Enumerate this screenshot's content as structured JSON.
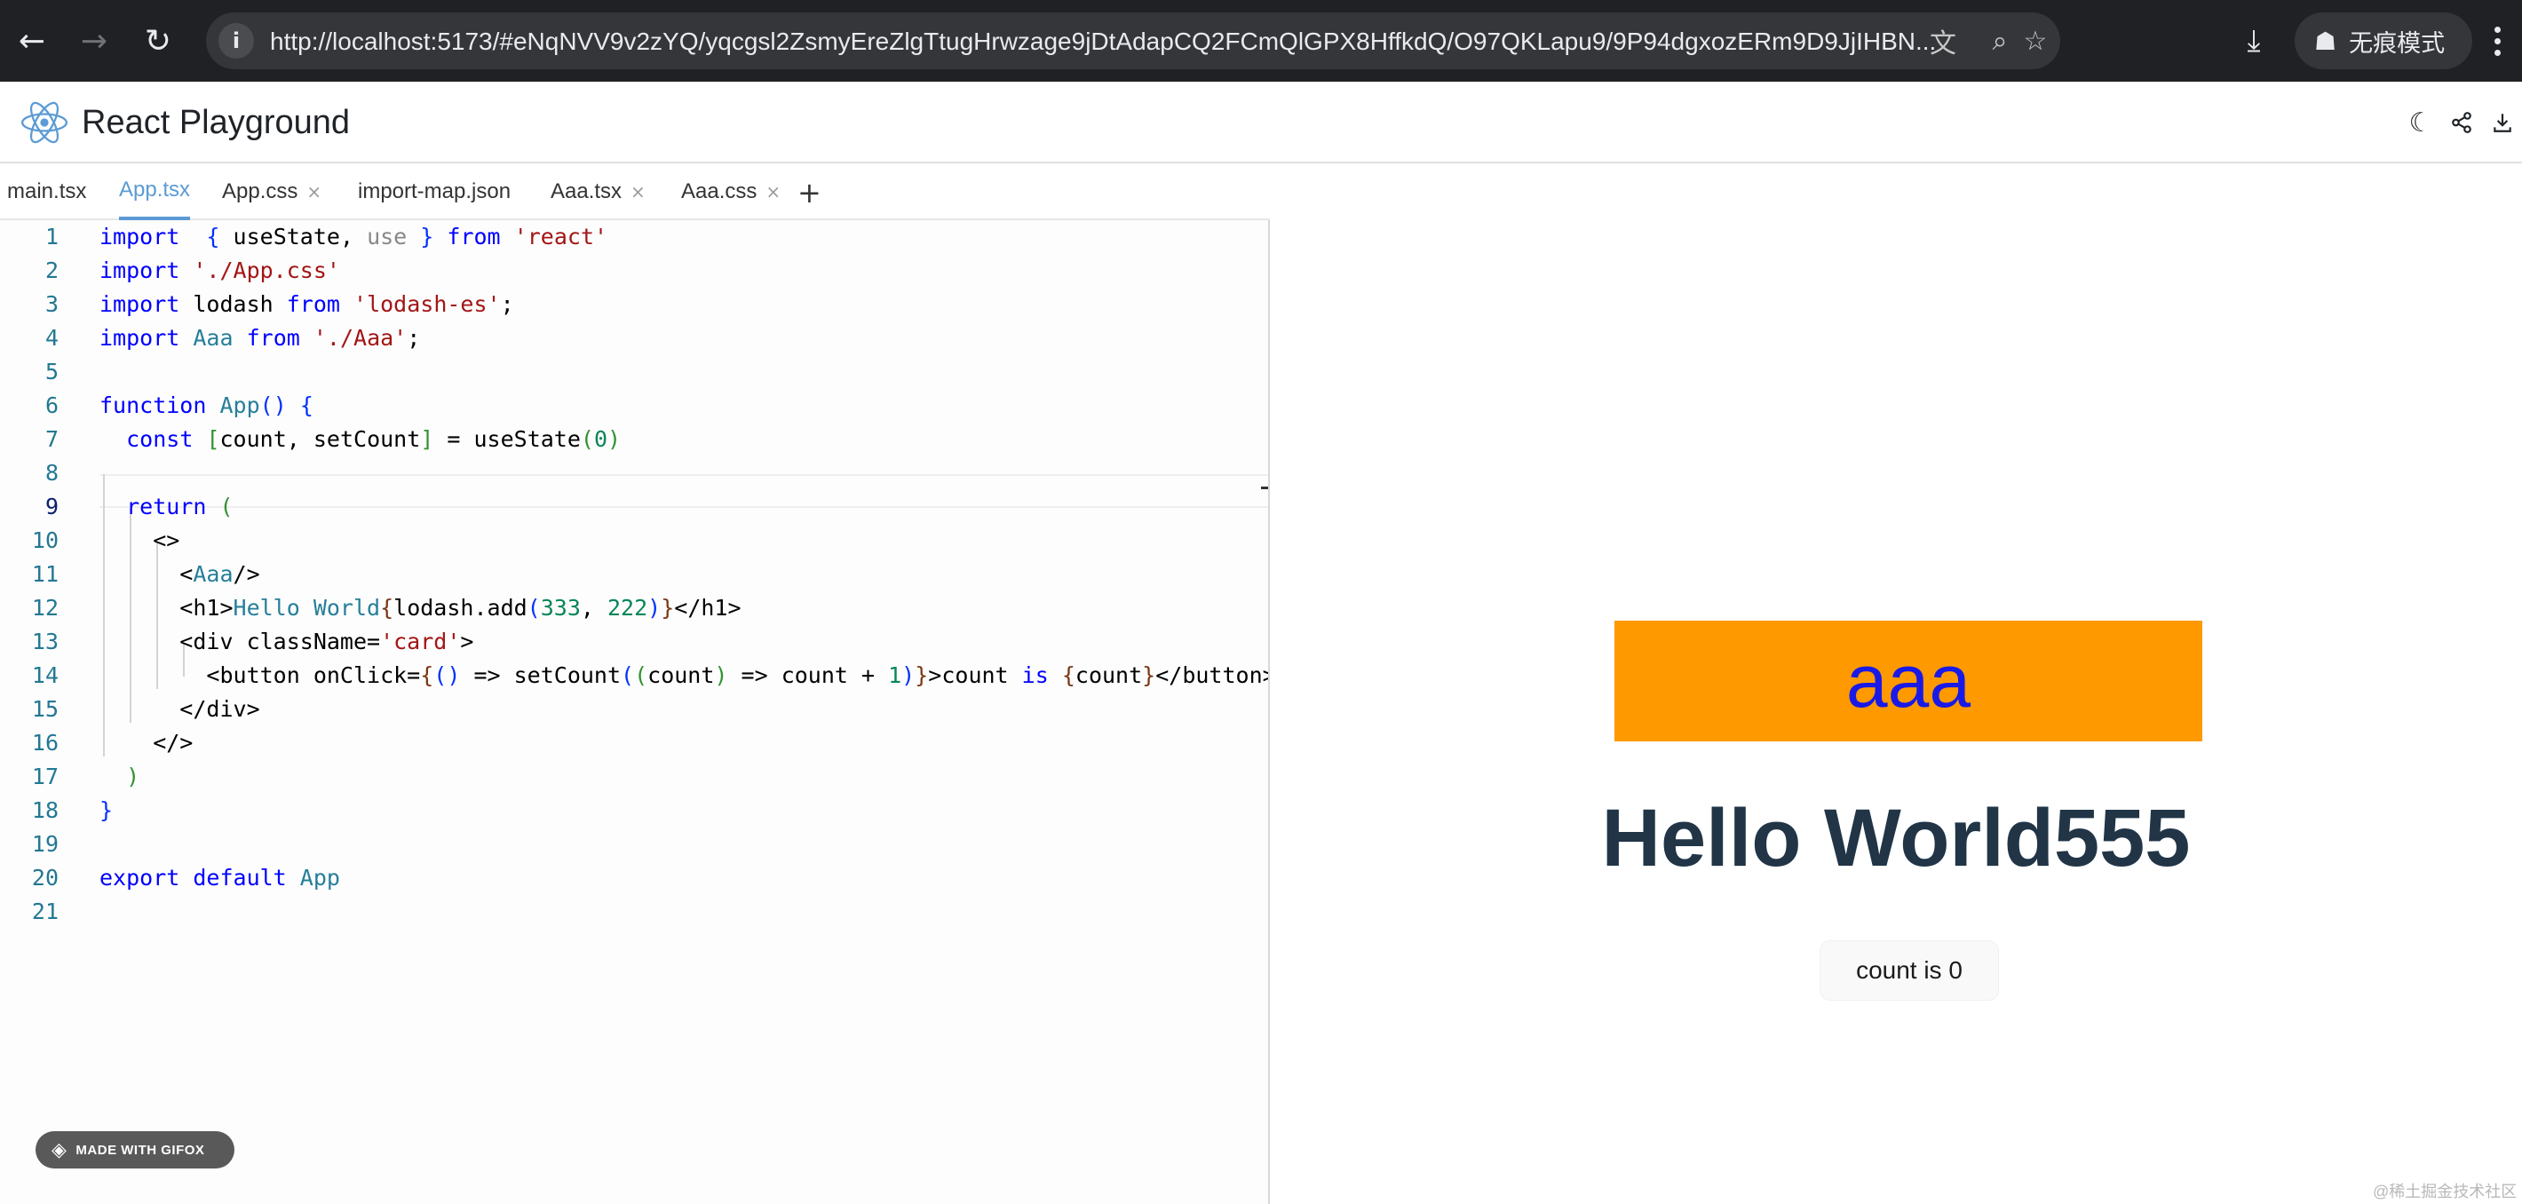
{
  "browser": {
    "url": "http://localhost:5173/#eNqNVV9v2zYQ/yqcgsl2ZsmyEreZlgTtugHrwzage9jDtAdapCQ2FCmQlGPX8HffkdQ/O97QKLapu9/9P94dgxozERm9D9JjIHBN...",
    "icons": {
      "back": "back-arrow-icon",
      "forward": "forward-arrow-icon",
      "reload": "reload-icon",
      "info": "site-info-icon",
      "translate": "translate-icon",
      "zoom": "zoom-icon",
      "bookmark": "star-icon",
      "download": "download-icon",
      "incognito": "incognito-icon",
      "menu": "kebab-menu-icon"
    },
    "incognito_label": "无痕模式"
  },
  "app": {
    "title": "React Playground",
    "header_icons": [
      "moon-icon",
      "share-icon",
      "download-icon"
    ]
  },
  "editor": {
    "tabs": [
      {
        "label": "main.tsx",
        "active": false,
        "closable": false
      },
      {
        "label": "App.tsx",
        "active": true,
        "closable": false
      },
      {
        "label": "App.css",
        "active": false,
        "closable": true
      },
      {
        "label": "import-map.json",
        "active": false,
        "closable": false
      },
      {
        "label": "Aaa.tsx",
        "active": false,
        "closable": true
      },
      {
        "label": "Aaa.css",
        "active": false,
        "closable": true
      }
    ],
    "add_tab_label": "+",
    "close_glyph": "×",
    "current_line": 9,
    "lines": [
      {
        "n": "1",
        "tokens": [
          [
            "k",
            "import"
          ],
          [
            "",
            "  "
          ],
          [
            "b1",
            "{"
          ],
          [
            "",
            " useState, "
          ],
          [
            "g",
            "use"
          ],
          [
            "",
            " "
          ],
          [
            "b1",
            "}"
          ],
          [
            "",
            " "
          ],
          [
            "k",
            "from"
          ],
          [
            "",
            " "
          ],
          [
            "s",
            "'react'"
          ]
        ]
      },
      {
        "n": "2",
        "tokens": [
          [
            "k",
            "import"
          ],
          [
            "",
            " "
          ],
          [
            "s",
            "'./App.css'"
          ]
        ]
      },
      {
        "n": "3",
        "tokens": [
          [
            "k",
            "import"
          ],
          [
            "",
            " lodash "
          ],
          [
            "k",
            "from"
          ],
          [
            "",
            " "
          ],
          [
            "s",
            "'lodash-es'"
          ],
          [
            "",
            ";"
          ]
        ]
      },
      {
        "n": "4",
        "tokens": [
          [
            "k",
            "import"
          ],
          [
            "",
            " "
          ],
          [
            "t",
            "Aaa"
          ],
          [
            "",
            " "
          ],
          [
            "k",
            "from"
          ],
          [
            "",
            " "
          ],
          [
            "s",
            "'./Aaa'"
          ],
          [
            "",
            ";"
          ]
        ]
      },
      {
        "n": "5",
        "tokens": []
      },
      {
        "n": "6",
        "tokens": [
          [
            "k",
            "function"
          ],
          [
            "",
            " "
          ],
          [
            "t",
            "App"
          ],
          [
            "b1",
            "()"
          ],
          [
            "",
            " "
          ],
          [
            "b1",
            "{"
          ]
        ]
      },
      {
        "n": "7",
        "tokens": [
          [
            "",
            "  "
          ],
          [
            "k",
            "const"
          ],
          [
            "",
            " "
          ],
          [
            "b2",
            "["
          ],
          [
            "",
            "count, setCount"
          ],
          [
            "b2",
            "]"
          ],
          [
            "",
            " = useState"
          ],
          [
            "b2",
            "("
          ],
          [
            "n",
            "0"
          ],
          [
            "b2",
            ")"
          ]
        ]
      },
      {
        "n": "8",
        "tokens": []
      },
      {
        "n": "9",
        "tokens": [
          [
            "",
            "  "
          ],
          [
            "k",
            "return"
          ],
          [
            "",
            " "
          ],
          [
            "b2",
            "("
          ]
        ]
      },
      {
        "n": "10",
        "tokens": [
          [
            "",
            "    <>"
          ]
        ]
      },
      {
        "n": "11",
        "tokens": [
          [
            "",
            "      <"
          ],
          [
            "t",
            "Aaa"
          ],
          [
            "",
            "/>"
          ]
        ]
      },
      {
        "n": "12",
        "tokens": [
          [
            "",
            "      <h1>"
          ],
          [
            "t",
            "Hello World"
          ],
          [
            "b3",
            "{"
          ],
          [
            "",
            "lodash.add"
          ],
          [
            "b1",
            "("
          ],
          [
            "n",
            "333"
          ],
          [
            "",
            ", "
          ],
          [
            "n",
            "222"
          ],
          [
            "b1",
            ")"
          ],
          [
            "b3",
            "}"
          ],
          [
            "",
            "</h1>"
          ]
        ]
      },
      {
        "n": "13",
        "tokens": [
          [
            "",
            "      <div className="
          ],
          [
            "s",
            "'card'"
          ],
          [
            "",
            ">"
          ]
        ]
      },
      {
        "n": "14",
        "tokens": [
          [
            "",
            "        <button onClick="
          ],
          [
            "b3",
            "{"
          ],
          [
            "b1",
            "()"
          ],
          [
            "",
            " => setCount"
          ],
          [
            "b1",
            "("
          ],
          [
            "b2",
            "("
          ],
          [
            "",
            "count"
          ],
          [
            "b2",
            ")"
          ],
          [
            "",
            " => count + "
          ],
          [
            "n",
            "1"
          ],
          [
            "b1",
            ")"
          ],
          [
            "b3",
            "}"
          ],
          [
            "",
            ">count "
          ],
          [
            "k",
            "is"
          ],
          [
            "",
            " "
          ],
          [
            "b3",
            "{"
          ],
          [
            "",
            "count"
          ],
          [
            "b3",
            "}"
          ],
          [
            "",
            "</button>"
          ]
        ]
      },
      {
        "n": "15",
        "tokens": [
          [
            "",
            "      </div>"
          ]
        ]
      },
      {
        "n": "16",
        "tokens": [
          [
            "",
            "    </>"
          ]
        ]
      },
      {
        "n": "17",
        "tokens": [
          [
            "",
            "  "
          ],
          [
            "b2",
            ")"
          ]
        ]
      },
      {
        "n": "18",
        "tokens": [
          [
            "b1",
            "}"
          ]
        ]
      },
      {
        "n": "19",
        "tokens": []
      },
      {
        "n": "20",
        "tokens": [
          [
            "k",
            "export"
          ],
          [
            "",
            " "
          ],
          [
            "k",
            "default"
          ],
          [
            "",
            " "
          ],
          [
            "t",
            "App"
          ]
        ]
      },
      {
        "n": "21",
        "tokens": []
      }
    ],
    "badge": "MADE WITH GIFOX"
  },
  "preview": {
    "aaa_text": "aaa",
    "heading": "Hello World555",
    "button_label": "count is 0",
    "colors": {
      "aaa_bg": "#ff9900",
      "aaa_text": "#1a1ae6",
      "heading": "#213547"
    },
    "watermark": "@稀土掘金技术社区"
  }
}
